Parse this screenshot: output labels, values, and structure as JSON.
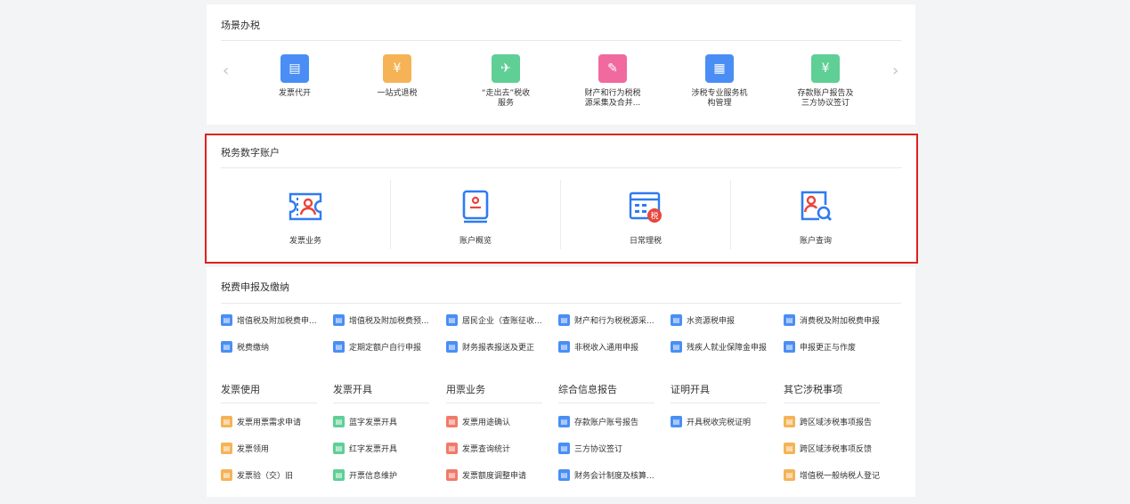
{
  "scene": {
    "title": "场景办税",
    "prev": "‹",
    "next": "›",
    "items": [
      {
        "label": "发票代开",
        "color": "#4a8ef5"
      },
      {
        "label": "一站式退税",
        "color": "#f5b356"
      },
      {
        "label": "“走出去”税收\n服务",
        "color": "#5fcf96"
      },
      {
        "label": "财产和行为税税\n源采集及合并...",
        "color": "#f06aa0"
      },
      {
        "label": "涉税专业服务机\n构管理",
        "color": "#4a8ef5"
      },
      {
        "label": "存款账户报告及\n三方协议签订",
        "color": "#5fcf96"
      }
    ]
  },
  "account": {
    "title": "税务数字账户",
    "items": [
      {
        "label": "发票业务"
      },
      {
        "label": "账户概览"
      },
      {
        "label": "日常理税",
        "badge": "税"
      },
      {
        "label": "账户查询"
      }
    ],
    "accent": "#2f7bf2",
    "badge_color": "#e8453c"
  },
  "declare": {
    "title": "税费申报及缴纳",
    "rows": [
      [
        "增值税及附加税费申...",
        "增值税及附加税费预...",
        "居民企业（查账征收...",
        "财产和行为税税源采...",
        "水资源税申报",
        "消费税及附加税费申报"
      ],
      [
        "税费缴纳",
        "定期定额户自行申报",
        "财务报表报送及更正",
        "非税收入通用申报",
        "残疾人就业保障金申报",
        "申报更正与作废"
      ]
    ],
    "icon_color": "#4a8ef5"
  },
  "invoice": {
    "columns": [
      {
        "title": "发票使用",
        "items": [
          "发票用票需求申请",
          "发票领用",
          "发票验（交）旧"
        ],
        "color": "#f5b356"
      },
      {
        "title": "发票开具",
        "items": [
          "蓝字发票开具",
          "红字发票开具",
          "开票信息维护"
        ],
        "color": "#5fcf96"
      },
      {
        "title": "用票业务",
        "items": [
          "发票用途确认",
          "发票查询统计",
          "发票额度调整申请"
        ],
        "color": "#f07a6a"
      },
      {
        "title": "综合信息报告",
        "items": [
          "存款账户账号报告",
          "三方协议签订",
          "财务会计制度及核算..."
        ],
        "color": "#4a8ef5"
      },
      {
        "title": "证明开具",
        "items": [
          "开具税收完税证明"
        ],
        "color": "#4a8ef5"
      },
      {
        "title": "其它涉税事项",
        "items": [
          "跨区域涉税事项报告",
          "跨区域涉税事项反馈",
          "增值税一般纳税人登记"
        ],
        "color": "#f5b356"
      }
    ]
  }
}
